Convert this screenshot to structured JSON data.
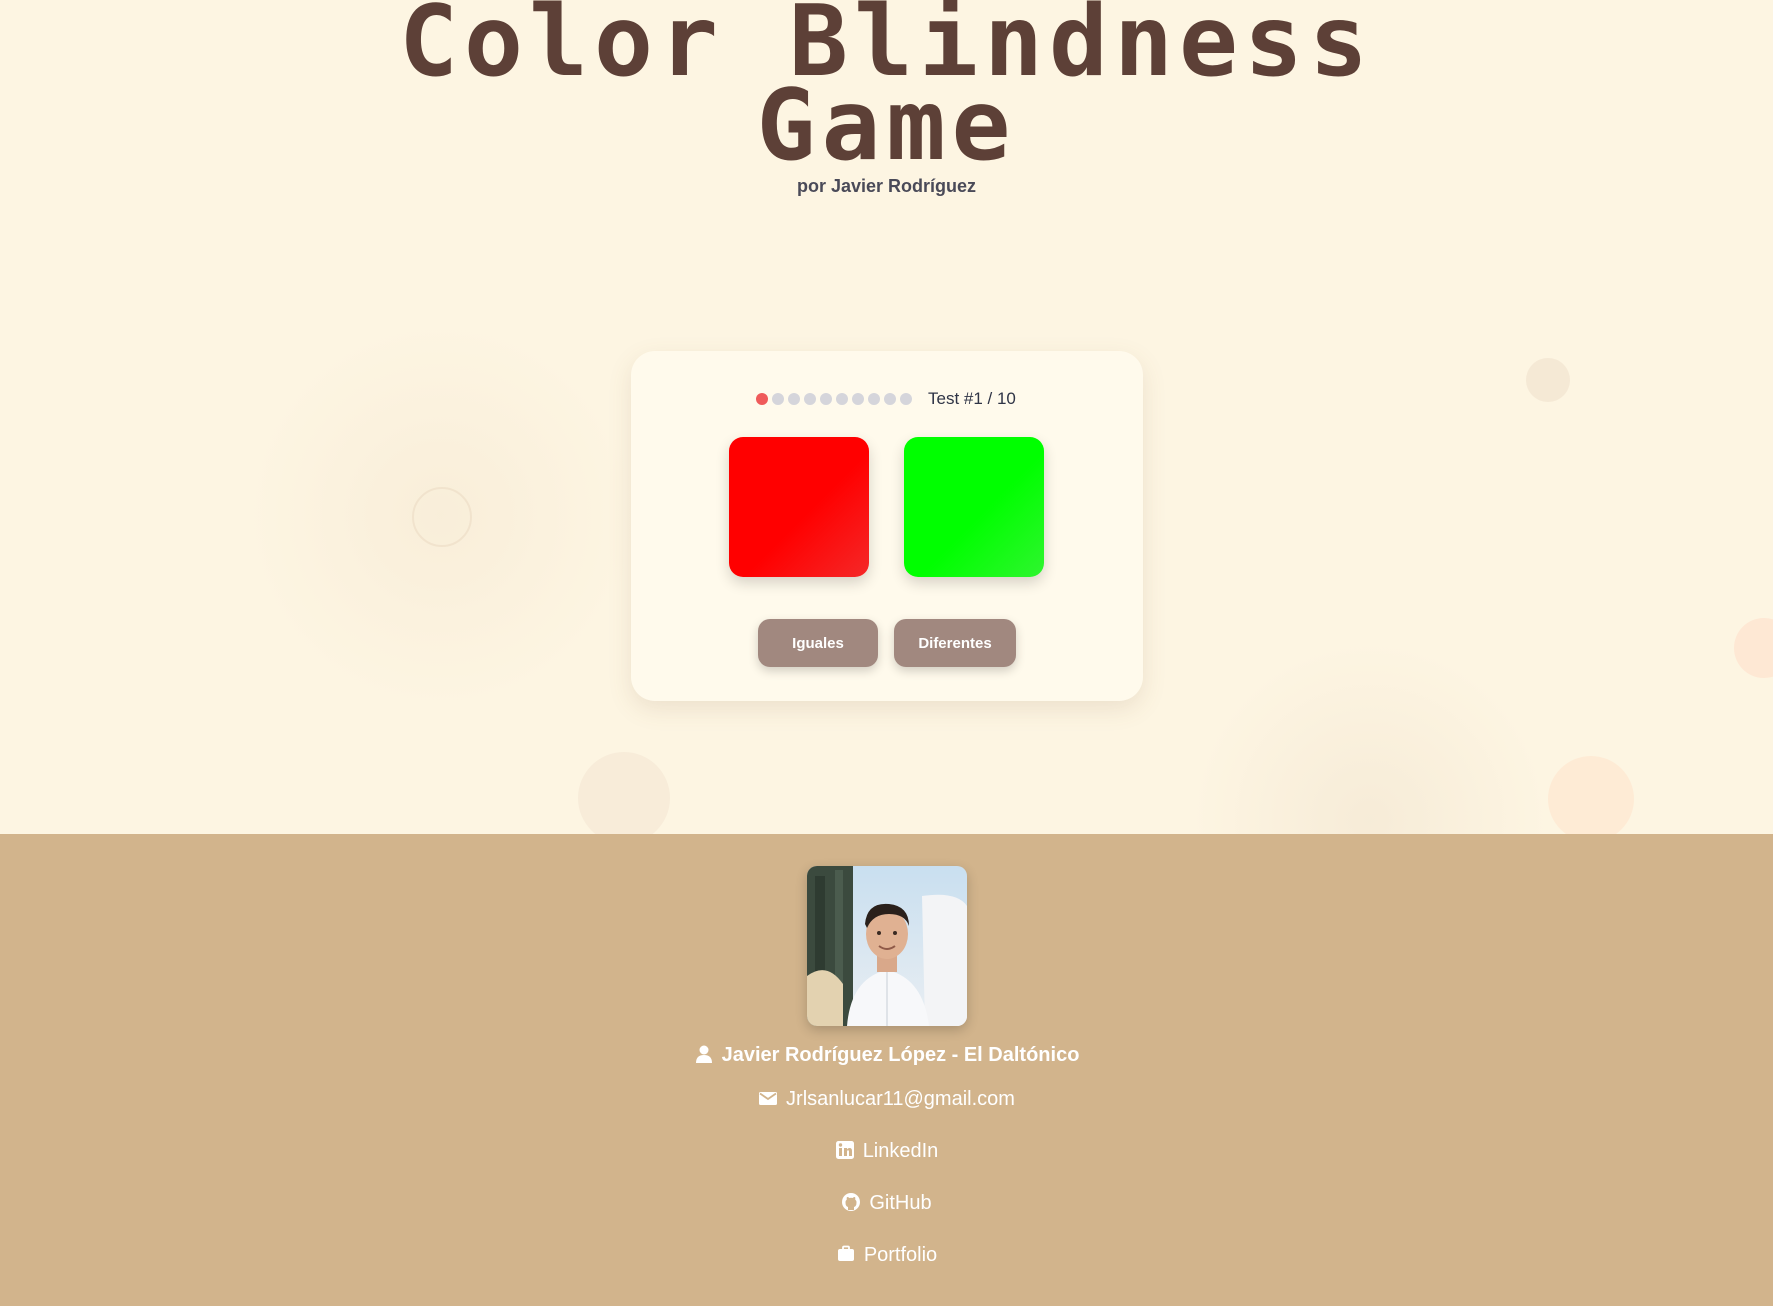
{
  "header": {
    "title_line1": "Color Blindness",
    "title_line2": "Game",
    "subtitle": "por Javier Rodríguez"
  },
  "game": {
    "current_test": 1,
    "total_tests": 10,
    "progress_label": "Test #1 / 10",
    "swatch_left_color": "#ff0000",
    "swatch_right_color": "#00ff00",
    "buttons": {
      "same_label": "Iguales",
      "different_label": "Diferentes"
    }
  },
  "footer": {
    "name": "Javier Rodríguez López - El Daltónico",
    "email": "Jrlsanlucar11@gmail.com",
    "links": {
      "linkedin": "LinkedIn",
      "github": "GitHub",
      "portfolio": "Portfolio"
    },
    "icons": [
      "user-icon",
      "mail-icon",
      "linkedin-icon",
      "github-icon",
      "briefcase-icon"
    ]
  },
  "colors": {
    "background": "#fdf5e2",
    "title": "#5d4037",
    "button": "#a1887f",
    "footer": "#d2b48c",
    "active_dot": "#ef5a5a"
  }
}
